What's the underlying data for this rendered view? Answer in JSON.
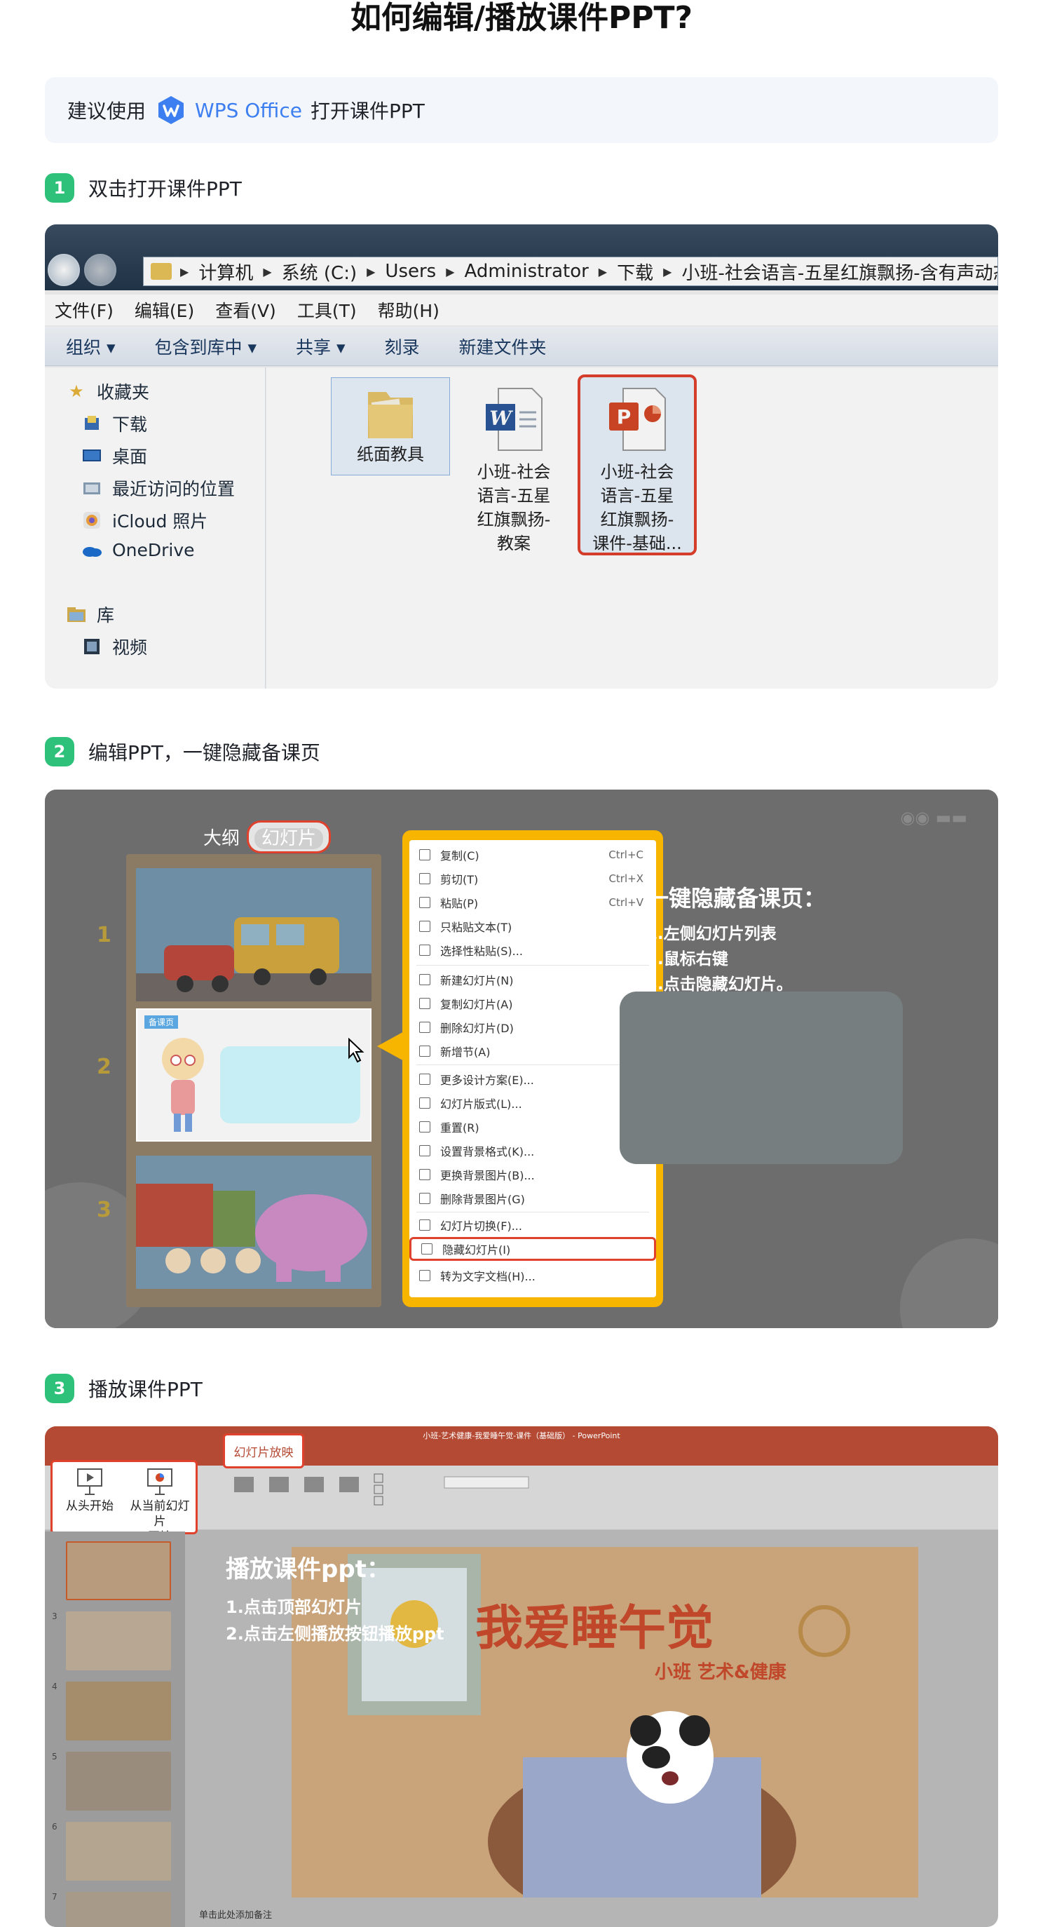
{
  "page": {
    "title": "如何编辑/播放课件PPT?"
  },
  "tip": {
    "prefix": "建议使用",
    "app_name": "WPS Office",
    "suffix": "打开课件PPT"
  },
  "steps": [
    {
      "num": "1",
      "label": "双击打开课件PPT"
    },
    {
      "num": "2",
      "label": "编辑PPT，一键隐藏备课页"
    },
    {
      "num": "3",
      "label": "播放课件PPT"
    }
  ],
  "explorer": {
    "address": [
      "计算机",
      "系统 (C:)",
      "Users",
      "Administrator",
      "下载",
      "小班-社会语言-五星红旗飘扬-含有声动态"
    ],
    "menu": [
      "文件(F)",
      "编辑(E)",
      "查看(V)",
      "工具(T)",
      "帮助(H)"
    ],
    "toolbar": [
      "组织 ▾",
      "包含到库中 ▾",
      "共享 ▾",
      "刻录",
      "新建文件夹"
    ],
    "sidebar": [
      "收藏夹",
      "下载",
      "桌面",
      "最近访问的位置",
      "iCloud 照片",
      "OneDrive",
      "库",
      "视频"
    ],
    "files": [
      {
        "lines": [
          "纸面教具"
        ]
      },
      {
        "lines": [
          "小班-社会",
          "语言-五星",
          "红旗飘扬-",
          "教案"
        ]
      },
      {
        "lines": [
          "小班-社会",
          "语言-五星",
          "红旗飘扬-",
          "课件-基础..."
        ]
      }
    ]
  },
  "edit": {
    "view_tabs": {
      "outline": "大纲",
      "slides": "幻灯片"
    },
    "slide_numbers": [
      "1",
      "2",
      "3"
    ],
    "thumb2_tag": "备课页",
    "menu": [
      {
        "label": "复制(C)",
        "shortcut": "Ctrl+C"
      },
      {
        "label": "剪切(T)",
        "shortcut": "Ctrl+X"
      },
      {
        "label": "粘贴(P)",
        "shortcut": "Ctrl+V"
      },
      {
        "label": "只粘贴文本(T)",
        "shortcut": ""
      },
      {
        "label": "选择性粘贴(S)...",
        "shortcut": ""
      },
      {
        "label": "新建幻灯片(N)",
        "shortcut": ""
      },
      {
        "label": "复制幻灯片(A)",
        "shortcut": ""
      },
      {
        "label": "删除幻灯片(D)",
        "shortcut": ""
      },
      {
        "label": "新增节(A)",
        "shortcut": ""
      },
      {
        "label": "更多设计方案(E)...",
        "shortcut": ""
      },
      {
        "label": "幻灯片版式(L)...",
        "shortcut": ""
      },
      {
        "label": "重置(R)",
        "shortcut": ""
      },
      {
        "label": "设置背景格式(K)...",
        "shortcut": ""
      },
      {
        "label": "更换背景图片(B)...",
        "shortcut": ""
      },
      {
        "label": "删除背景图片(G)",
        "shortcut": ""
      },
      {
        "label": "幻灯片切换(F)...",
        "shortcut": ""
      },
      {
        "label": "隐藏幻灯片(I)",
        "shortcut": ""
      },
      {
        "label": "转为文字文档(H)...",
        "shortcut": ""
      }
    ],
    "tip_title": "一键隐藏备课页：",
    "tip_lines": [
      "1.左侧幻灯片列表",
      "2.鼠标右键",
      "3.点击隐藏幻灯片。"
    ]
  },
  "play": {
    "window_title": "小班-艺术健康-我爱睡午觉-课件（基础版） - PowerPoint",
    "active_tab": "幻灯片放映",
    "buttons": [
      {
        "lines": [
          "从头开始"
        ]
      },
      {
        "lines": [
          "从当前幻灯片",
          "开始"
        ]
      }
    ],
    "thumb_numbers": [
      "3",
      "4",
      "5",
      "6",
      "7"
    ],
    "overlay_title": "播放课件ppt：",
    "overlay_lines": [
      "1.点击顶部幻灯片",
      "2.点击左侧播放按钮播放ppt"
    ],
    "slide_title": "我爱睡午觉",
    "slide_subtitle": "小班  艺术&健康",
    "notes_hint": "单击此处添加备注"
  },
  "colors": {
    "accent_green": "#2ec17a",
    "highlight_red": "#e0412c",
    "wps_blue": "#3d7ef0",
    "menu_orange": "#f7b500",
    "ppt_red": "#b54a34"
  }
}
